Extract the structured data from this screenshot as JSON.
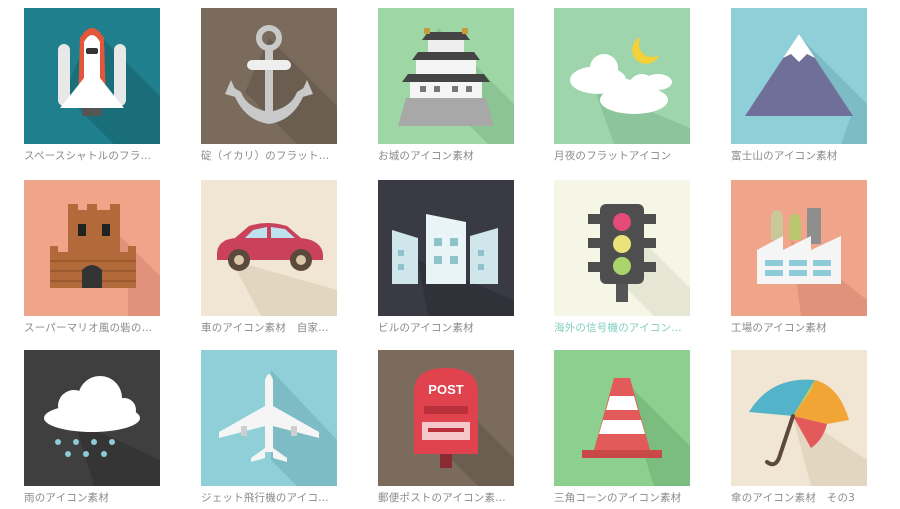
{
  "items": [
    {
      "label": "スペースシャトルのフラ…",
      "icon": "space-shuttle-icon",
      "bg": "#1f7f8c"
    },
    {
      "label": "碇（イカリ）のフラット…",
      "icon": "anchor-icon",
      "bg": "#7b6b5c"
    },
    {
      "label": "お城のアイコン素材",
      "icon": "castle-icon",
      "bg": "#9fd6a6"
    },
    {
      "label": "月夜のフラットアイコン",
      "icon": "moon-night-icon",
      "bg": "#9ed5ad"
    },
    {
      "label": "富士山のアイコン素材",
      "icon": "mount-fuji-icon",
      "bg": "#8fcfd8"
    },
    {
      "label": "スーパーマリオ風の砦の…",
      "icon": "fortress-icon",
      "bg": "#f0a58a"
    },
    {
      "label": "車のアイコン素材　自家…",
      "icon": "car-icon",
      "bg": "#f1e6d3"
    },
    {
      "label": "ビルのアイコン素材",
      "icon": "buildings-icon",
      "bg": "#3a3a44"
    },
    {
      "label": "海外の信号機のアイコン…",
      "icon": "traffic-light-icon",
      "bg": "#f6f6e6",
      "active": true
    },
    {
      "label": "工場のアイコン素材",
      "icon": "factory-icon",
      "bg": "#f0a58a"
    },
    {
      "label": "雨のアイコン素材",
      "icon": "rain-cloud-icon",
      "bg": "#3f3f3f"
    },
    {
      "label": "ジェット飛行機のアイコ…",
      "icon": "airplane-icon",
      "bg": "#8fcfd8"
    },
    {
      "label": "郵便ポストのアイコン素…",
      "icon": "mailbox-icon",
      "bg": "#7b6b5c",
      "post": "POST"
    },
    {
      "label": "三角コーンのアイコン素材",
      "icon": "traffic-cone-icon",
      "bg": "#8ccf8e"
    },
    {
      "label": "傘のアイコン素材　その3",
      "icon": "umbrella-icon",
      "bg": "#f1e6d3"
    }
  ]
}
